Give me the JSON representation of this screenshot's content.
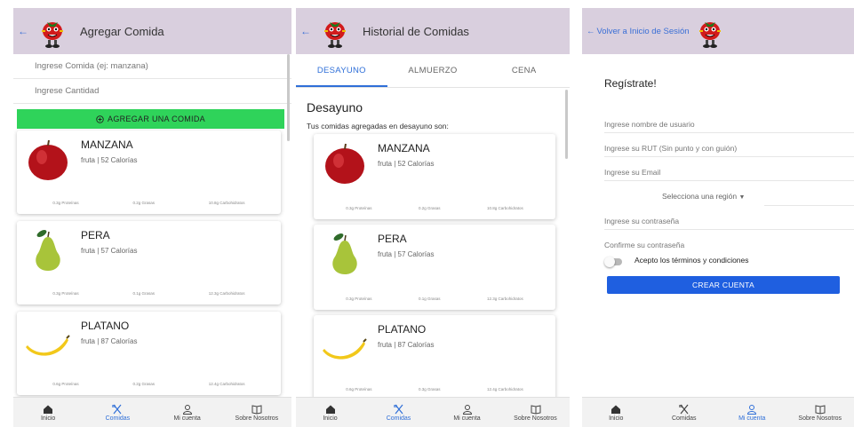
{
  "screen1": {
    "title": "Agregar Comida",
    "food_placeholder": "Ingrese Comida (ej: manzana)",
    "quantity_placeholder": "Ingrese Cantidad",
    "add_button": "AGREGAR UNA COMIDA",
    "cards": [
      {
        "name": "MANZANA",
        "sub": "fruta | 52 Calorías",
        "protein": "0.3g Proteínas",
        "fat": "0.2g Grasas",
        "carbs": "10.8g Carbohidratos",
        "fruit": "apple-icon"
      },
      {
        "name": "PERA",
        "sub": "fruta | 57 Calorías",
        "protein": "0.3g Proteínas",
        "fat": "0.1g Grasas",
        "carbs": "12.3g Carbohidratos",
        "fruit": "pear-icon"
      },
      {
        "name": "PLATANO",
        "sub": "fruta | 87 Calorías",
        "protein": "0.6g Proteínas",
        "fat": "0.2g Grasas",
        "carbs": "12.4g Carbohidratos",
        "fruit": "banana-icon"
      }
    ]
  },
  "screen2": {
    "title": "Historial de Comidas",
    "tabs": [
      "DESAYUNO",
      "ALMUERZO",
      "CENA"
    ],
    "section_title": "Desayuno",
    "section_sub": "Tus comidas agregadas en desayuno son:",
    "cards": [
      {
        "name": "MANZANA",
        "sub": "fruta | 52 Calorías",
        "protein": "0.3g Proteínas",
        "fat": "0.2g Grasas",
        "carbs": "10.8g Carbohidratos"
      },
      {
        "name": "PERA",
        "sub": "fruta | 57 Calorías",
        "protein": "0.3g Proteínas",
        "fat": "0.1g Grasas",
        "carbs": "12.3g Carbohidratos"
      },
      {
        "name": "PLATANO",
        "sub": "fruta | 87 Calorías",
        "protein": "0.6g Proteínas",
        "fat": "0.3g Grasas",
        "carbs": "12.4g Carbohidratos"
      }
    ]
  },
  "screen3": {
    "back_label": "Volver a Inicio de Sesión",
    "title": "Regístrate!",
    "username": "Ingrese nombre de usuario",
    "rut": "Ingrese su RUT (Sin punto y con guión)",
    "email": "Ingrese su Email",
    "region": "Selecciona una región",
    "password": "Ingrese su contraseña",
    "confirm": "Confirme su contraseña",
    "terms": "Acepto los términos y condiciones",
    "create_button": "CREAR CUENTA"
  },
  "nav": {
    "inicio": "Inicio",
    "comidas": "Comidas",
    "cuenta": "Mi cuenta",
    "nosotros": "Sobre Nosotros"
  },
  "colors": {
    "header": "#d9cfde",
    "accent": "#2f6fd8",
    "add_button": "#2fd35a",
    "create_button": "#1f5fe0"
  }
}
